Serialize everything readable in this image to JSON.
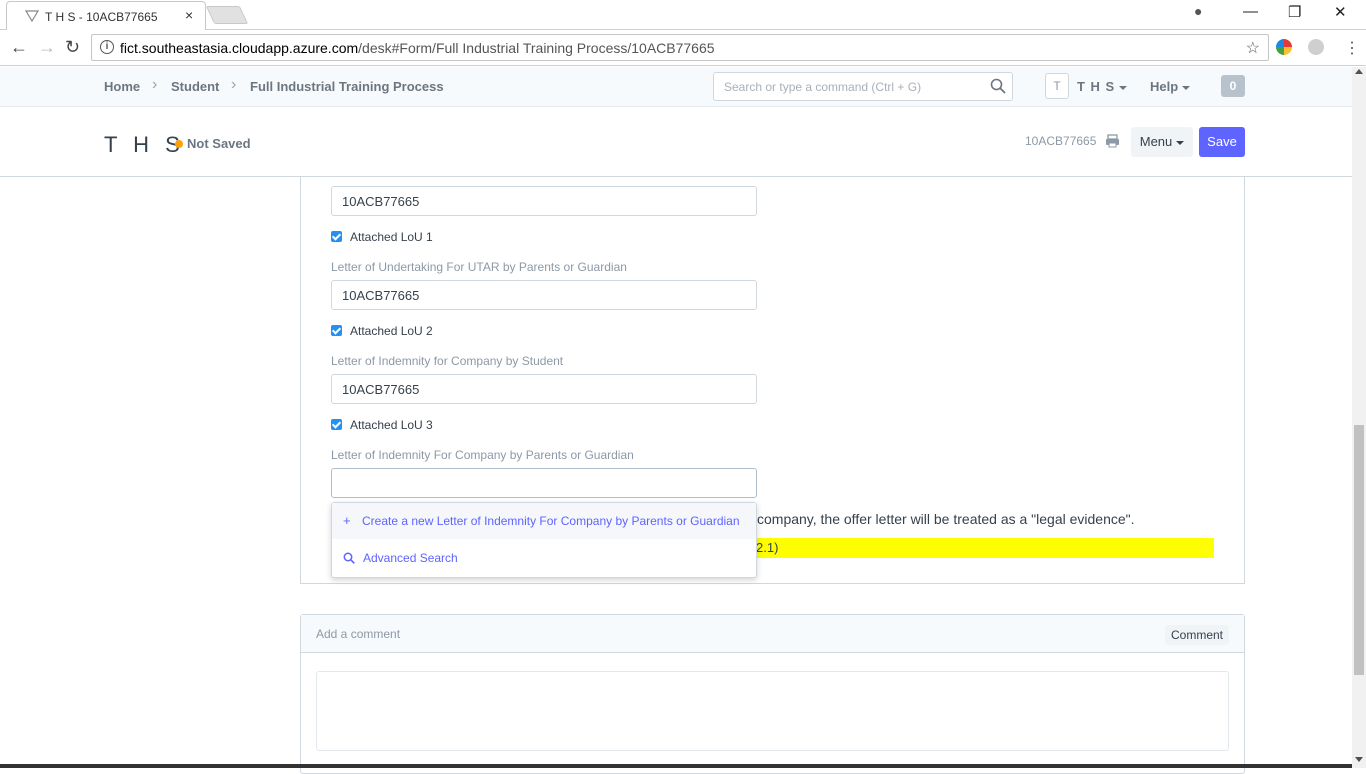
{
  "browser": {
    "tab_title": "T H S - 10ACB77665",
    "tab_close": "×",
    "url_host": "fict.southeastasia.cloudapp.azure.com",
    "url_path": "/desk#Form/Full Industrial Training Process/10ACB77665",
    "info_glyph": "i",
    "star_glyph": "☆",
    "back_glyph": "←",
    "forward_glyph": "→",
    "reload_glyph": "↻",
    "kebab_glyph": "⋮",
    "minimize_glyph": "—",
    "restore_glyph": "❐",
    "close_glyph": "✕",
    "profile_glyph": "●"
  },
  "navbar": {
    "breadcrumbs": [
      "Home",
      "Student",
      "Full Industrial Training Process"
    ],
    "crumb_sep": "›",
    "search_placeholder": "Search or type a command (Ctrl + G)",
    "avatar_letter": "T",
    "user_name": "T H S",
    "help_label": "Help",
    "notification_count": "0"
  },
  "page_head": {
    "title": "T H S",
    "status": "Not Saved",
    "doc_id": "10ACB77665",
    "menu_label": "Menu",
    "save_label": "Save"
  },
  "form": {
    "field1_value": "10ACB77665",
    "check1_label": "Attached LoU 1",
    "field2_label": "Letter of Undertaking For UTAR by Parents or Guardian",
    "field2_value": "10ACB77665",
    "check2_label": "Attached LoU 2",
    "field3_label": "Letter of Indemnity for Company by Student",
    "field3_value": "10ACB77665",
    "check3_label": "Attached LoU 3",
    "field4_label": "Letter of Indemnity For Company by Parents or Guardian",
    "field4_value": "",
    "note_text": "company, the offer letter will be treated as a \"legal evidence\".",
    "highlight_text": "2.1)"
  },
  "dropdown": {
    "create_icon": "+",
    "create_label": "Create a new Letter of Indemnity For Company by Parents or Guardian",
    "search_label": "Advanced Search"
  },
  "comment": {
    "placeholder": "Add a comment",
    "button_label": "Comment"
  },
  "colors": {
    "primary": "#5e64ff",
    "status_dot": "#ffa00a",
    "checkbox": "#2490ef",
    "highlight": "#ffff00"
  }
}
